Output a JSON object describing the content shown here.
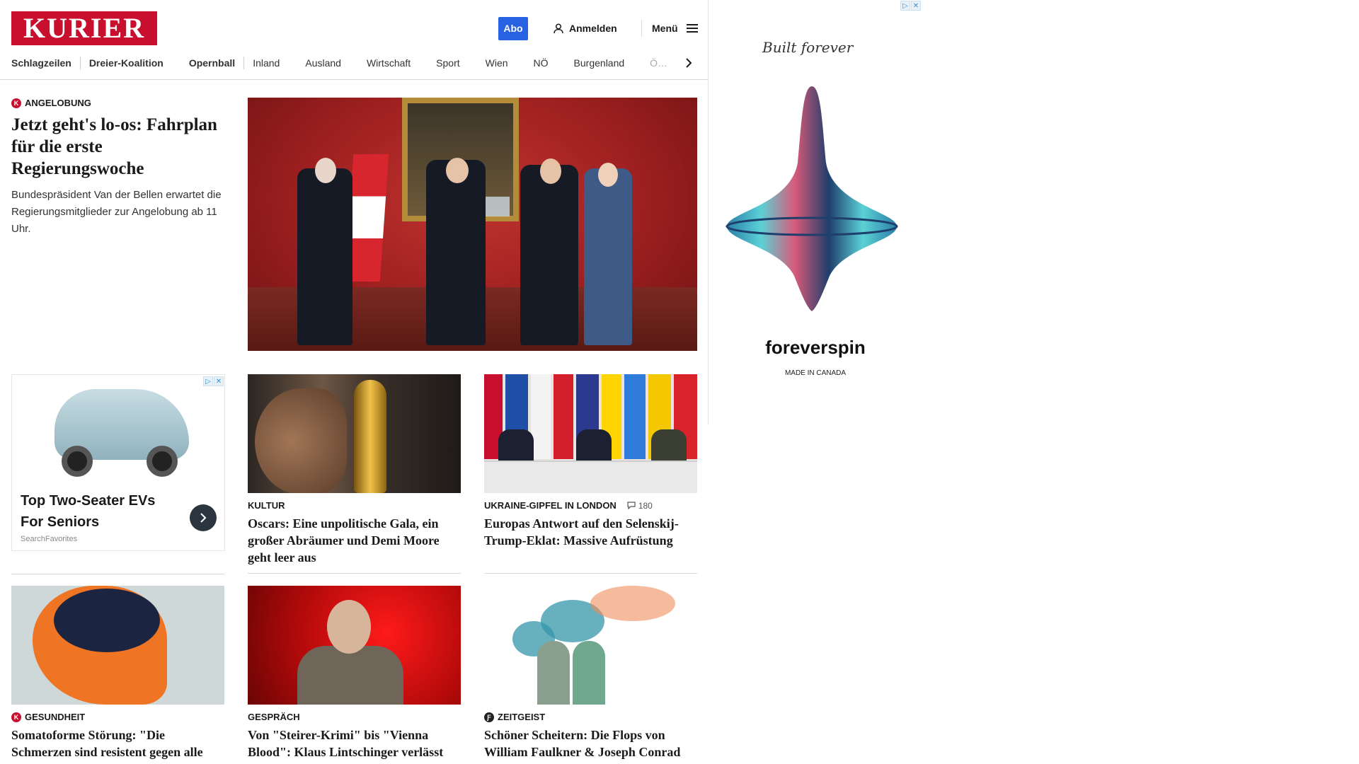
{
  "header": {
    "logo": "KURIER",
    "abo": "Abo",
    "login": "Anmelden",
    "menu": "Menü"
  },
  "nav": [
    "Schlagzeilen",
    "Dreier-Koalition",
    "Opernball",
    "Inland",
    "Ausland",
    "Wirtschaft",
    "Sport",
    "Wien",
    "NÖ",
    "Burgenland",
    "Ö…"
  ],
  "lead": {
    "kicker": "ANGELOBUNG",
    "headline": "Jetzt geht's lo-os: Fahrplan für die erste Regierungswoche",
    "teaser": "Bundespräsident Van der Bellen erwartet die Regierungsmitglieder zur Angelobung ab 11 Uhr."
  },
  "native_ad": {
    "title": "Top Two-Seater EVs For Seniors",
    "source": "SearchFavorites"
  },
  "articles": [
    {
      "kicker": "KULTUR",
      "headline": "Oscars: Eine unpolitische Gala, ein großer Abräumer und Demi Moore geht leer aus"
    },
    {
      "kicker": "UKRAINE-GIPFEL IN LONDON",
      "comments": "180",
      "headline": "Europas Antwort auf den Selenskij-Trump-Eklat: Massive Aufrüstung"
    },
    {
      "kicker": "GESUNDHEIT",
      "headline": "Somatoforme Störung: \"Die Schmerzen sind resistent gegen alle Behandlungen\""
    },
    {
      "kicker": "GESPRÄCH",
      "headline": "Von \"Steirer-Krimi\" bis \"Vienna Blood\": Klaus Lintschinger verlässt ORF"
    },
    {
      "kicker": "ZEITGEIST",
      "headline": "Schöner Scheitern: Die Flops von William Faulkner & Joseph Conrad"
    }
  ],
  "side_ad": {
    "script": "Built forever",
    "brand": "foreverspin",
    "made": "MADE IN CANADA"
  },
  "colors": {
    "brand_red": "#c8102e",
    "abo_blue": "#2762e3"
  }
}
